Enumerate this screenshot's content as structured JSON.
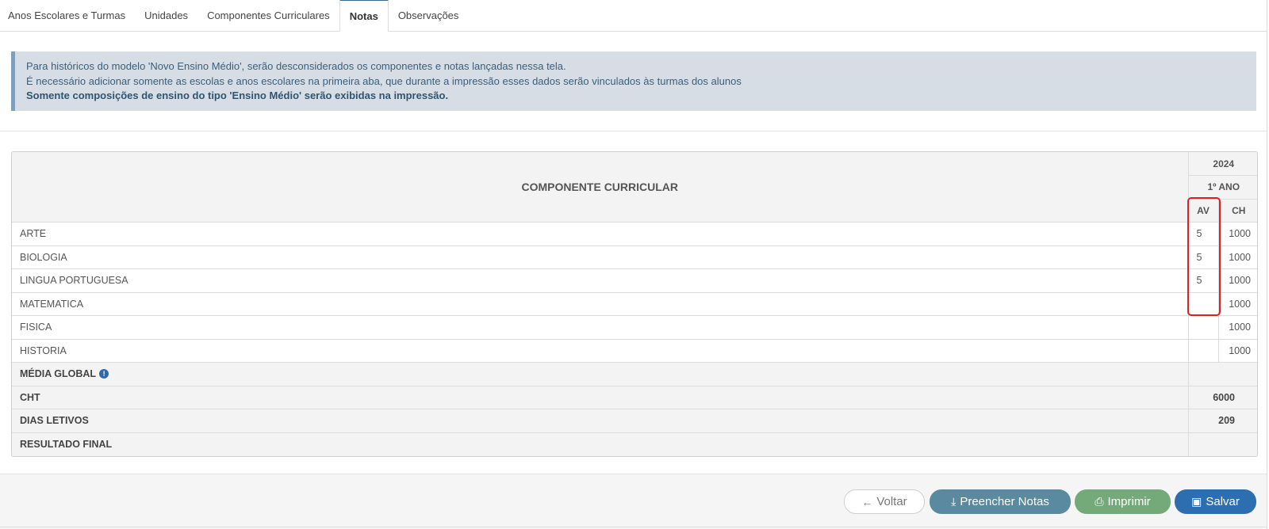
{
  "tabs": [
    {
      "label": "Anos Escolares e Turmas"
    },
    {
      "label": "Unidades"
    },
    {
      "label": "Componentes Curriculares"
    },
    {
      "label": "Notas"
    },
    {
      "label": "Observações"
    }
  ],
  "active_tab": "Notas",
  "info": {
    "line1": "Para históricos do modelo 'Novo Ensino Médio', serão desconsiderados os componentes e notas lançadas nessa tela.",
    "line2": "É necessário adicionar somente as escolas e anos escolares na primeira aba, que durante a impressão esses dados serão vinculados às turmas dos alunos",
    "line3": "Somente composições de ensino do tipo 'Ensino Médio' serão exibidas na impressão."
  },
  "table": {
    "header_component": "COMPONENTE CURRICULAR",
    "year": "2024",
    "serie": "1º ANO",
    "col_av": "AV",
    "col_ch": "CH",
    "rows": [
      {
        "name": "ARTE",
        "av": "5",
        "ch": "1000"
      },
      {
        "name": "BIOLOGIA",
        "av": "5",
        "ch": "1000"
      },
      {
        "name": "LINGUA PORTUGUESA",
        "av": "5",
        "ch": "1000"
      },
      {
        "name": "MATEMATICA",
        "av": "",
        "ch": "1000"
      },
      {
        "name": "FISICA",
        "av": "",
        "ch": "1000"
      },
      {
        "name": "HISTORIA",
        "av": "",
        "ch": "1000"
      }
    ],
    "summary": {
      "media_global_label": "MÉDIA GLOBAL",
      "media_global_icon": "!",
      "media_global_value": "",
      "cht_label": "CHT",
      "cht_value": "6000",
      "dias_label": "DIAS LETIVOS",
      "dias_value": "209",
      "resultado_label": "RESULTADO FINAL",
      "resultado_value": ""
    }
  },
  "buttons": {
    "voltar": "Voltar",
    "preencher": "Preencher Notas",
    "imprimir": "Imprimir",
    "salvar": "Salvar"
  },
  "colors": {
    "primary": "#2d6eb0",
    "preencher": "#5a8aa0",
    "imprimir": "#74a97a",
    "highlight": "#e02020",
    "info_bg": "#d6dde5"
  }
}
